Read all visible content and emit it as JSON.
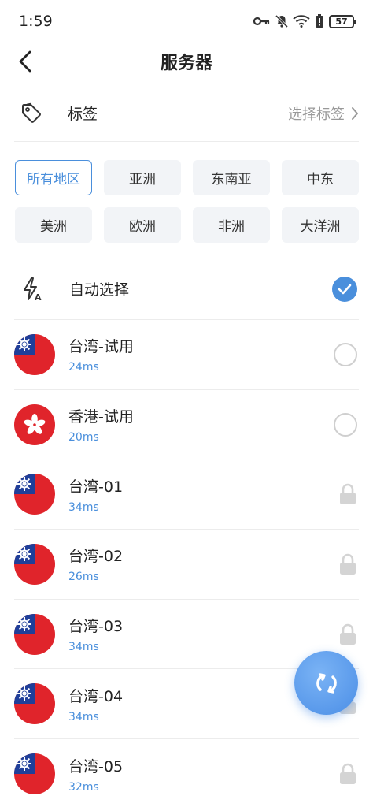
{
  "status_bar": {
    "time": "1:59",
    "battery": "57",
    "icons": [
      "key-icon",
      "bell-muted-icon",
      "wifi-icon",
      "battery-saver-icon",
      "battery-icon"
    ]
  },
  "header": {
    "title": "服务器",
    "back_icon": "chevron-left-icon"
  },
  "tag_filter": {
    "label": "标签",
    "value": "选择标签",
    "icon": "tag-icon"
  },
  "regions": [
    {
      "label": "所有地区",
      "selected": true
    },
    {
      "label": "亚洲",
      "selected": false
    },
    {
      "label": "东南亚",
      "selected": false
    },
    {
      "label": "中东",
      "selected": false
    },
    {
      "label": "美洲",
      "selected": false
    },
    {
      "label": "欧洲",
      "selected": false
    },
    {
      "label": "非洲",
      "selected": false
    },
    {
      "label": "大洋洲",
      "selected": false
    }
  ],
  "auto_select": {
    "label": "自动选择",
    "selected": true,
    "icon": "auto-lightning-icon"
  },
  "servers": [
    {
      "name": "台湾-试用",
      "ping": "24ms",
      "flag": "taiwan-flag-icon",
      "state": "radio"
    },
    {
      "name": "香港-试用",
      "ping": "20ms",
      "flag": "hongkong-flag-icon",
      "state": "radio"
    },
    {
      "name": "台湾-01",
      "ping": "34ms",
      "flag": "taiwan-flag-icon",
      "state": "locked"
    },
    {
      "name": "台湾-02",
      "ping": "26ms",
      "flag": "taiwan-flag-icon",
      "state": "locked"
    },
    {
      "name": "台湾-03",
      "ping": "34ms",
      "flag": "taiwan-flag-icon",
      "state": "locked"
    },
    {
      "name": "台湾-04",
      "ping": "34ms",
      "flag": "taiwan-flag-icon",
      "state": "locked"
    },
    {
      "name": "台湾-05",
      "ping": "32ms",
      "flag": "taiwan-flag-icon",
      "state": "locked"
    }
  ],
  "fab": {
    "icon": "refresh-icon"
  },
  "colors": {
    "accent": "#4a8fdc",
    "flag_red": "#e0242b",
    "flag_blue": "#1f3f9a"
  }
}
